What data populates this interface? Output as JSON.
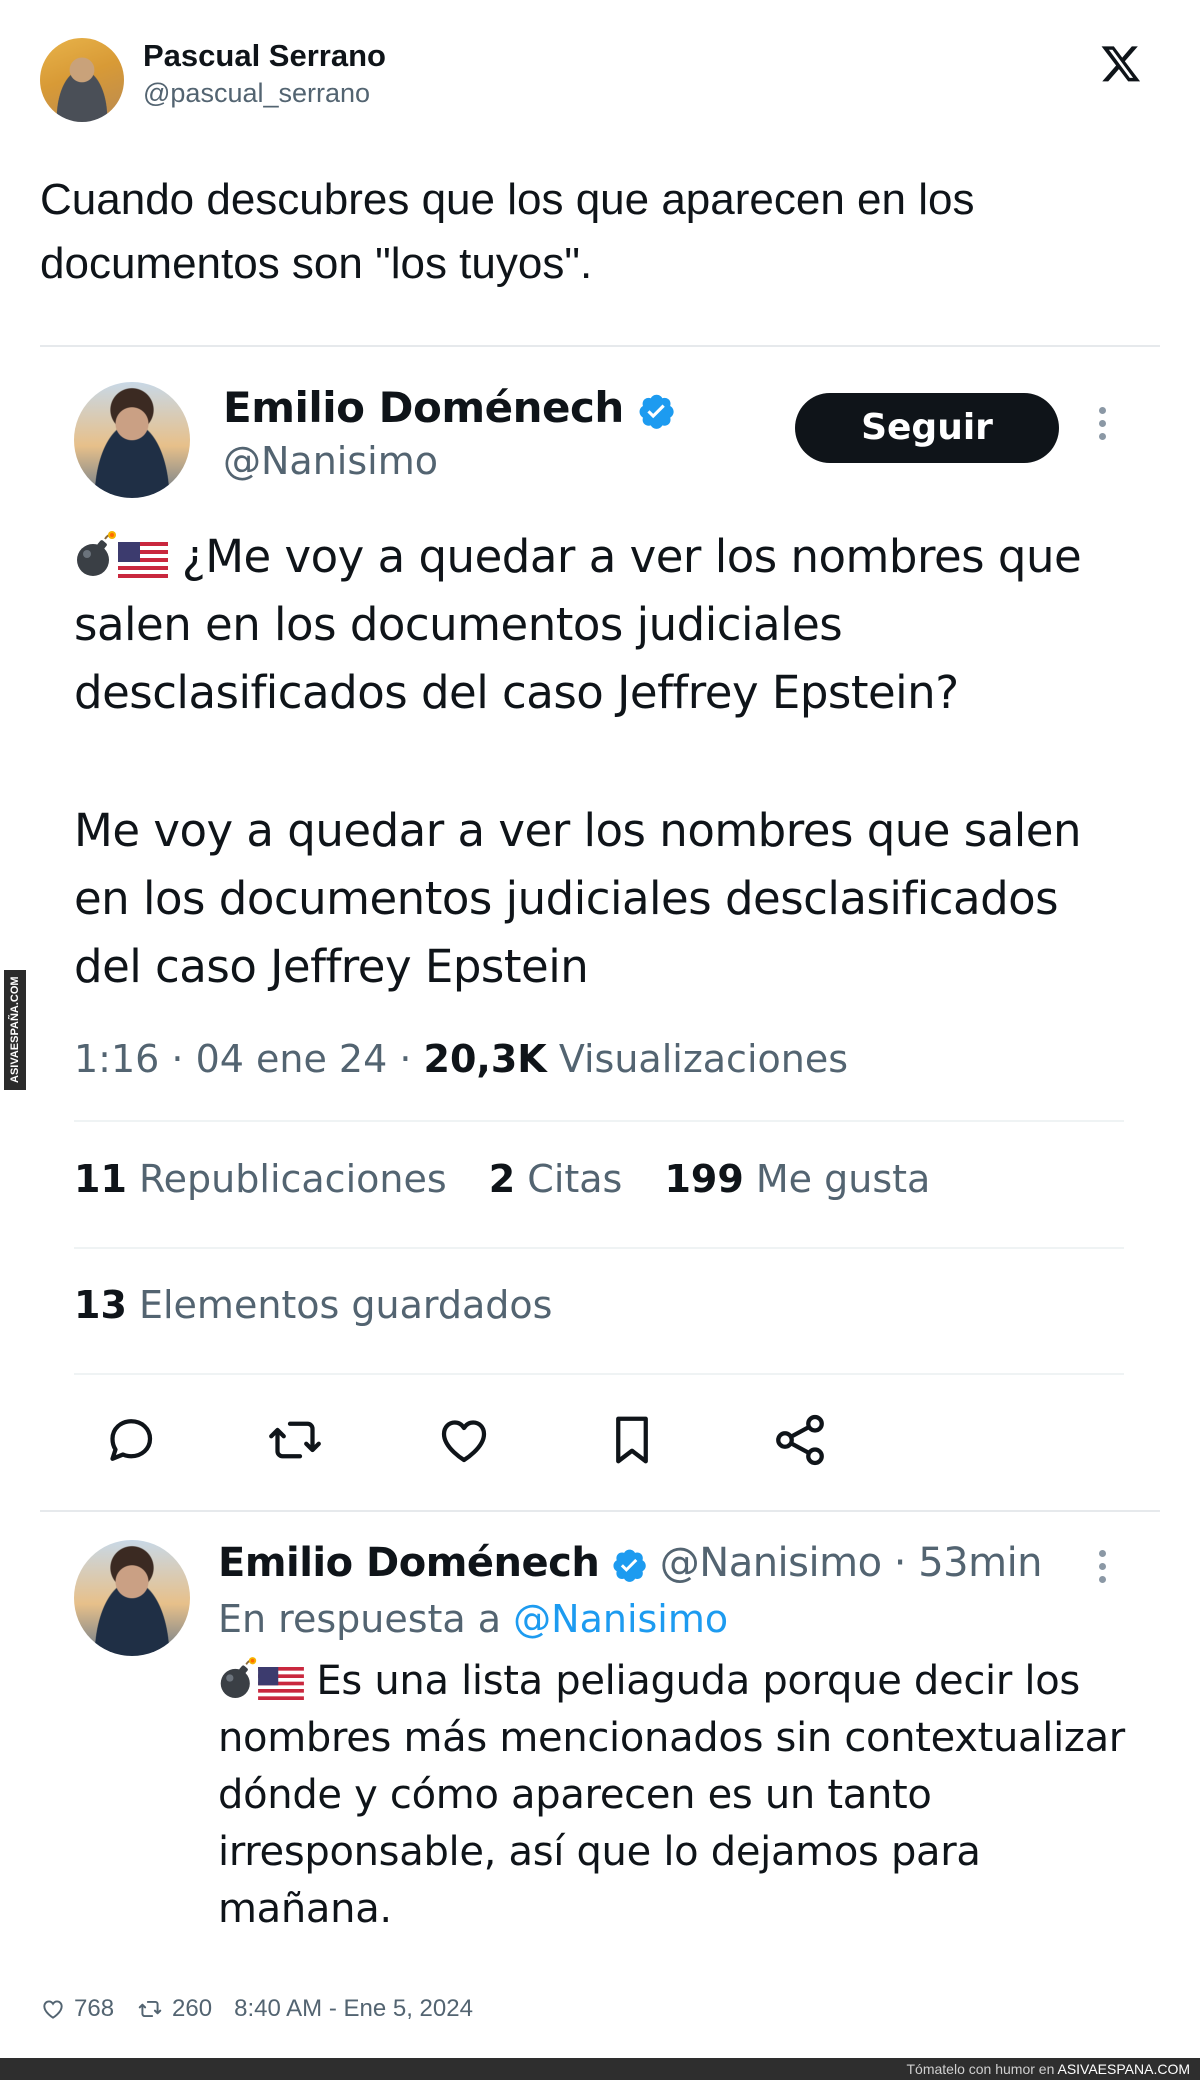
{
  "outer": {
    "name": "Pascual Serrano",
    "handle": "@pascual_serrano",
    "text": "Cuando descubres que los que aparecen en los documentos son \"los tuyos\"."
  },
  "card": {
    "name": "Emilio Doménech",
    "handle": "@Nanisimo",
    "follow_label": "Seguir",
    "body1": "¿Me voy a quedar a ver los nombres que salen en los documentos judiciales desclasificados del caso Jeffrey Epstein?",
    "body2": "Me voy a quedar a ver los nombres que salen en los documentos judiciales desclasificados del caso Jeffrey Epstein",
    "time": "1:16 · 04 ene 24 · ",
    "views_count": "20,3K",
    "views_label": "Visualizaciones",
    "reposts_count": "11",
    "reposts_label": "Republicaciones",
    "quotes_count": "2",
    "quotes_label": "Citas",
    "likes_count": "199",
    "likes_label": "Me gusta",
    "saved_count": "13",
    "saved_label": "Elementos guardados"
  },
  "reply": {
    "name": "Emilio Doménech",
    "handle_time": "@Nanisimo · 53min",
    "reply_to_prefix": "En respuesta a ",
    "reply_to_handle": "@Nanisimo",
    "body": "Es una lista peliaguda porque decir los nombres más mencionados sin contextualizar dónde y cómo aparecen es un tanto irresponsable, así que lo dejamos para mañana."
  },
  "footer": {
    "likes": "768",
    "retweets": "260",
    "timestamp": "8:40 AM - Ene 5, 2024"
  },
  "watermark": {
    "side": "ASIVAESPAÑA.COM",
    "bottom_prefix": "Tómatelo con humor en ",
    "bottom_site": "ASIVAESPANA.COM"
  },
  "colors": {
    "accent": "#1d9bf0",
    "text": "#0f1419",
    "muted": "#536471"
  },
  "icons": [
    "x-logo",
    "verified-badge-icon",
    "bomb-emoji",
    "us-flag-emoji",
    "reply-icon",
    "repost-icon",
    "like-icon",
    "bookmark-icon",
    "share-icon",
    "more-icon"
  ]
}
